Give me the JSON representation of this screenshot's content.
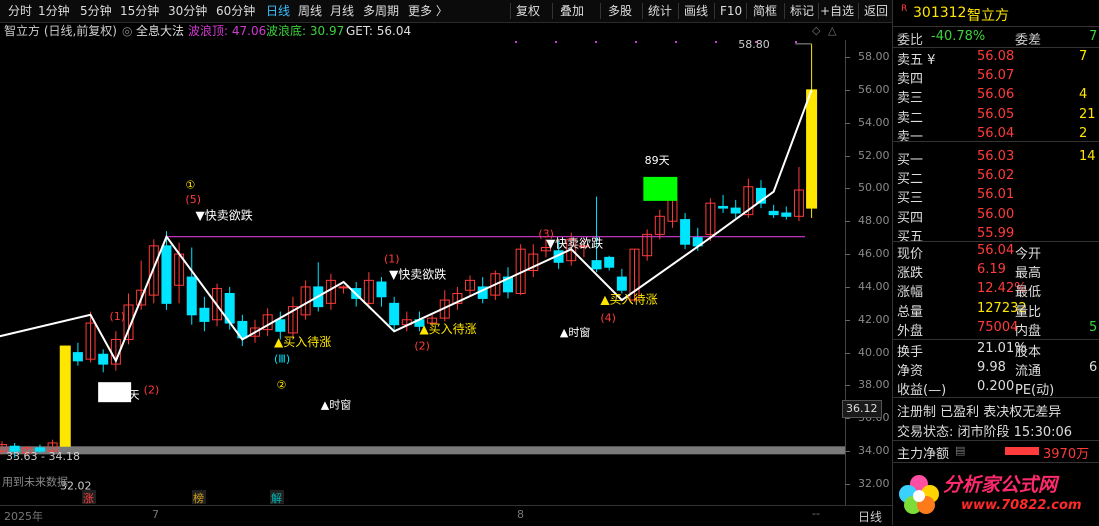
{
  "toolbar": {
    "periods": [
      "分时",
      "1分钟",
      "5分钟",
      "15分钟",
      "30分钟",
      "60分钟",
      "日线",
      "周线",
      "月线",
      "多周期",
      "更多 〉"
    ],
    "active_period": "日线",
    "actions": [
      "复权",
      "叠加",
      "多股",
      "统计",
      "画线",
      "F10",
      "简框",
      "标记",
      "+自选",
      "返回"
    ]
  },
  "infobar": {
    "title": "智立方 (日线,前复权)",
    "indicator": "全息大法",
    "wave_top_label": "波浪顶: 47.06",
    "wave_bottom_label": "波浪底: 30.97",
    "get_label": "GET: 56.04"
  },
  "colors": {
    "up": "#ff3b3b",
    "down": "#00e5ff",
    "highlight": "#ffe600",
    "magenta": "#d43bd4",
    "green": "#00ff00"
  },
  "chart_data": {
    "type": "candlestick",
    "yticks": [
      "58.00",
      "56.00",
      "54.00",
      "52.00",
      "50.00",
      "48.00",
      "46.00",
      "44.00",
      "42.00",
      "40.00",
      "38.00",
      "36.00",
      "34.00",
      "32.00"
    ],
    "current_price_tag": "36.12",
    "high_label": "58.80",
    "price_range_label": "33.63 - 34.18",
    "low_label": "32.02",
    "x_labels": [
      "2025年",
      "7",
      "8"
    ],
    "candles": [
      {
        "o": 34.0,
        "c": 34.4,
        "h": 34.6,
        "l": 33.8
      },
      {
        "o": 34.3,
        "c": 34.0,
        "h": 34.5,
        "l": 33.6
      },
      {
        "o": 33.9,
        "c": 34.2,
        "h": 34.3,
        "l": 33.7
      },
      {
        "o": 34.2,
        "c": 34.0,
        "h": 34.4,
        "l": 33.9
      },
      {
        "o": 34.0,
        "c": 34.5,
        "h": 34.7,
        "l": 33.9
      },
      {
        "o": 34.3,
        "c": 40.4,
        "h": 40.4,
        "l": 34.3
      },
      {
        "o": 40.0,
        "c": 39.5,
        "h": 40.6,
        "l": 39.2
      },
      {
        "o": 39.6,
        "c": 41.8,
        "h": 42.5,
        "l": 39.4
      },
      {
        "o": 39.9,
        "c": 39.3,
        "h": 40.2,
        "l": 38.8
      },
      {
        "o": 39.3,
        "c": 40.8,
        "h": 41.3,
        "l": 38.9
      },
      {
        "o": 40.8,
        "c": 42.9,
        "h": 43.6,
        "l": 40.5
      },
      {
        "o": 42.9,
        "c": 43.8,
        "h": 45.6,
        "l": 42.6
      },
      {
        "o": 43.5,
        "c": 46.5,
        "h": 46.9,
        "l": 43.0
      },
      {
        "o": 46.5,
        "c": 43.0,
        "h": 47.4,
        "l": 42.6
      },
      {
        "o": 44.1,
        "c": 46.0,
        "h": 46.7,
        "l": 43.0
      },
      {
        "o": 44.6,
        "c": 42.3,
        "h": 46.4,
        "l": 41.7
      },
      {
        "o": 42.7,
        "c": 41.9,
        "h": 43.4,
        "l": 41.3
      },
      {
        "o": 42.0,
        "c": 43.9,
        "h": 44.2,
        "l": 41.6
      },
      {
        "o": 43.6,
        "c": 41.8,
        "h": 44.0,
        "l": 41.4
      },
      {
        "o": 41.9,
        "c": 40.9,
        "h": 42.3,
        "l": 40.4
      },
      {
        "o": 41.0,
        "c": 41.5,
        "h": 42.0,
        "l": 40.6
      },
      {
        "o": 41.4,
        "c": 42.3,
        "h": 42.7,
        "l": 41.0
      },
      {
        "o": 42.0,
        "c": 41.3,
        "h": 42.5,
        "l": 40.8
      },
      {
        "o": 41.2,
        "c": 42.8,
        "h": 43.4,
        "l": 40.9
      },
      {
        "o": 42.3,
        "c": 44.0,
        "h": 44.4,
        "l": 42.0
      },
      {
        "o": 44.0,
        "c": 42.8,
        "h": 45.5,
        "l": 42.5
      },
      {
        "o": 43.0,
        "c": 44.4,
        "h": 44.8,
        "l": 42.6
      },
      {
        "o": 44.0,
        "c": 44.0,
        "h": 44.1,
        "l": 43.6
      },
      {
        "o": 43.9,
        "c": 43.3,
        "h": 44.3,
        "l": 42.8
      },
      {
        "o": 43.0,
        "c": 44.4,
        "h": 44.9,
        "l": 42.7
      },
      {
        "o": 44.3,
        "c": 43.4,
        "h": 44.6,
        "l": 42.8
      },
      {
        "o": 43.0,
        "c": 41.7,
        "h": 43.4,
        "l": 41.3
      },
      {
        "o": 41.7,
        "c": 42.0,
        "h": 42.5,
        "l": 41.3
      },
      {
        "o": 42.0,
        "c": 41.6,
        "h": 42.5,
        "l": 41.3
      },
      {
        "o": 41.8,
        "c": 42.1,
        "h": 42.3,
        "l": 41.6
      },
      {
        "o": 42.1,
        "c": 43.2,
        "h": 43.8,
        "l": 41.9
      },
      {
        "o": 43.0,
        "c": 43.6,
        "h": 44.0,
        "l": 42.6
      },
      {
        "o": 43.8,
        "c": 44.4,
        "h": 44.7,
        "l": 43.4
      },
      {
        "o": 44.0,
        "c": 43.3,
        "h": 44.6,
        "l": 43.0
      },
      {
        "o": 43.5,
        "c": 44.8,
        "h": 45.0,
        "l": 43.2
      },
      {
        "o": 44.6,
        "c": 43.7,
        "h": 45.2,
        "l": 43.3
      },
      {
        "o": 43.6,
        "c": 46.3,
        "h": 46.6,
        "l": 43.5
      },
      {
        "o": 45.0,
        "c": 46.0,
        "h": 46.6,
        "l": 44.6
      },
      {
        "o": 46.2,
        "c": 46.4,
        "h": 46.9,
        "l": 45.8
      },
      {
        "o": 46.2,
        "c": 45.5,
        "h": 46.8,
        "l": 45.1
      },
      {
        "o": 45.6,
        "c": 46.9,
        "h": 47.3,
        "l": 45.3
      },
      {
        "o": 46.5,
        "c": 46.5,
        "h": 46.9,
        "l": 45.8
      },
      {
        "o": 45.6,
        "c": 45.1,
        "h": 49.5,
        "l": 44.9
      },
      {
        "o": 45.8,
        "c": 45.2,
        "h": 45.9,
        "l": 45.0
      },
      {
        "o": 44.6,
        "c": 43.8,
        "h": 45.1,
        "l": 43.6
      },
      {
        "o": 43.2,
        "c": 46.3,
        "h": 46.3,
        "l": 43.1
      },
      {
        "o": 45.9,
        "c": 47.2,
        "h": 47.5,
        "l": 45.6
      },
      {
        "o": 47.2,
        "c": 48.3,
        "h": 48.7,
        "l": 46.9
      },
      {
        "o": 48.0,
        "c": 49.4,
        "h": 50.3,
        "l": 47.6
      },
      {
        "o": 48.1,
        "c": 46.6,
        "h": 48.5,
        "l": 46.3
      },
      {
        "o": 47.0,
        "c": 46.5,
        "h": 47.6,
        "l": 46.2
      },
      {
        "o": 47.2,
        "c": 49.1,
        "h": 49.4,
        "l": 46.8
      },
      {
        "o": 48.9,
        "c": 48.8,
        "h": 49.6,
        "l": 48.5
      },
      {
        "o": 48.8,
        "c": 48.5,
        "h": 49.3,
        "l": 48.2
      },
      {
        "o": 48.4,
        "c": 50.1,
        "h": 50.6,
        "l": 48.2
      },
      {
        "o": 50.0,
        "c": 49.1,
        "h": 50.5,
        "l": 48.8
      },
      {
        "o": 48.6,
        "c": 48.4,
        "h": 49.0,
        "l": 48.2
      },
      {
        "o": 48.5,
        "c": 48.3,
        "h": 48.9,
        "l": 48.1
      },
      {
        "o": 48.3,
        "c": 49.9,
        "h": 51.3,
        "l": 48.0
      },
      {
        "o": 48.8,
        "c": 56.0,
        "h": 58.8,
        "l": 48.2
      }
    ],
    "wave_line": [
      {
        "i": -4,
        "v": 40.3
      },
      {
        "i": 7,
        "v": 42.3
      },
      {
        "i": 9,
        "v": 39.5
      },
      {
        "i": 13,
        "v": 47.06
      },
      {
        "i": 19,
        "v": 40.8
      },
      {
        "i": 27,
        "v": 44.3
      },
      {
        "i": 31,
        "v": 41.3
      },
      {
        "i": 45,
        "v": 46.3
      },
      {
        "i": 49,
        "v": 43.2
      },
      {
        "i": 56,
        "v": 47.0
      },
      {
        "i": 61,
        "v": 49.8
      },
      {
        "i": 64,
        "v": 56.0
      }
    ],
    "wave_top": 47.06,
    "annotations": [
      {
        "text": "①",
        "color": "#ffe600",
        "i": 14.5,
        "v": 50.0
      },
      {
        "text": "(5)",
        "color": "#ff3b3b",
        "i": 14.5,
        "v": 49.1
      },
      {
        "text": "▼快卖欲跌",
        "color": "#ffffff",
        "i": 15.3,
        "v": 48.1
      },
      {
        "text": "(1)",
        "color": "#ff3b3b",
        "i": 8.5,
        "v": 42.0
      },
      {
        "text": "(2)",
        "color": "#ff3b3b",
        "i": 11.2,
        "v": 37.5
      },
      {
        "text": "▲买入待涨",
        "color": "#ffe600",
        "i": 21.5,
        "v": 40.4
      },
      {
        "text": "(Ⅲ)",
        "color": "#00e5ff",
        "i": 21.5,
        "v": 39.4
      },
      {
        "text": "②",
        "color": "#ffe600",
        "i": 21.7,
        "v": 37.8
      },
      {
        "text": "▲时窗",
        "color": "#ffffff",
        "i": 25.2,
        "v": 36.6
      },
      {
        "text": "(1)",
        "color": "#ff3b3b",
        "i": 30.2,
        "v": 45.5
      },
      {
        "text": "▼快卖欲跌",
        "color": "#ffffff",
        "i": 30.6,
        "v": 44.5
      },
      {
        "text": "▲买入待涨",
        "color": "#ffe600",
        "i": 33.0,
        "v": 41.2
      },
      {
        "text": "(2)",
        "color": "#ff3b3b",
        "i": 32.6,
        "v": 40.2
      },
      {
        "text": "(3)",
        "color": "#ff3b3b",
        "i": 42.4,
        "v": 47.0
      },
      {
        "text": "▼快卖欲跌",
        "color": "#ffffff",
        "i": 43.0,
        "v": 46.4
      },
      {
        "text": "▲时窗",
        "color": "#ffffff",
        "i": 44.1,
        "v": 41.0
      },
      {
        "text": "▲买入待涨",
        "color": "#ffe600",
        "i": 47.3,
        "v": 43.0
      },
      {
        "text": "(4)",
        "color": "#ff3b3b",
        "i": 47.3,
        "v": 41.9
      },
      {
        "text": "89天",
        "color": "#ffffff",
        "i": 50.8,
        "v": 51.5
      },
      {
        "text": "55天",
        "color": "#ffffff",
        "i": 8.9,
        "v": 37.2
      }
    ]
  },
  "bottom_markers": [
    "涨",
    "榜",
    "解"
  ],
  "bottom_label": "用到未来数据",
  "footer_tab": "日线",
  "right_panel": {
    "code": "301312",
    "name": "智立方",
    "weibi": [
      "委比",
      "-40.78%",
      "委差",
      "7"
    ],
    "orderbook": [
      {
        "label": "卖五 ¥",
        "price": "56.08",
        "vol": "7"
      },
      {
        "label": "卖四",
        "price": "56.07",
        "vol": ""
      },
      {
        "label": "卖三",
        "price": "56.06",
        "vol": "4"
      },
      {
        "label": "卖二",
        "price": "56.05",
        "vol": "21"
      },
      {
        "label": "卖一",
        "price": "56.04",
        "vol": "2"
      },
      {
        "label": "买一",
        "price": "56.03",
        "vol": "14"
      },
      {
        "label": "买二",
        "price": "56.02",
        "vol": ""
      },
      {
        "label": "买三",
        "price": "56.01",
        "vol": ""
      },
      {
        "label": "买四",
        "price": "56.00",
        "vol": ""
      },
      {
        "label": "买五",
        "price": "55.99",
        "vol": ""
      }
    ],
    "quote": [
      [
        "现价",
        "56.04",
        "今开",
        ""
      ],
      [
        "涨跌",
        "6.19",
        "最高",
        ""
      ],
      [
        "涨幅",
        "12.42%",
        "最低",
        ""
      ],
      [
        "总量",
        "127232",
        "量比",
        ""
      ],
      [
        "外盘",
        "75004",
        "内盘",
        "5"
      ]
    ],
    "info": [
      [
        "换手",
        "21.01%",
        "股本",
        ""
      ],
      [
        "净资",
        "9.98",
        "流通",
        "6"
      ],
      [
        "收益(—)",
        "0.200",
        "PE(动)",
        ""
      ]
    ],
    "tags": "注册制 已盈利 表决权无差异",
    "trade_status": "交易状态: 闭市阶段 15:30:06",
    "main_flow_label": "主力净额",
    "main_flow_value": "3970万",
    "watermark_title": "分析家公式网",
    "watermark_url": "www.70822.com"
  }
}
